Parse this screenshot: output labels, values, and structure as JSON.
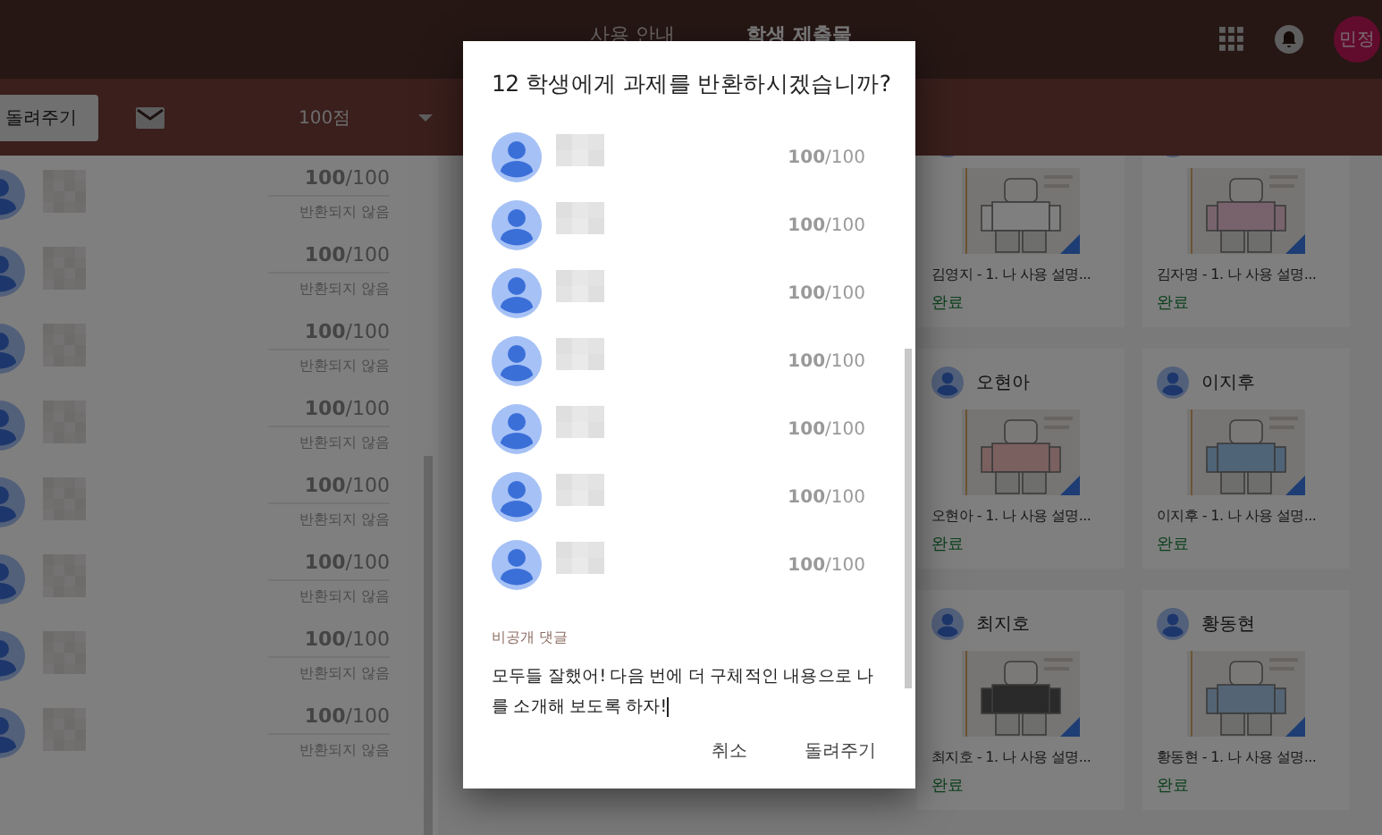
{
  "top_bar": {
    "tabs": [
      {
        "label": "사용 안내",
        "selected": false
      },
      {
        "label": "학생 제출물",
        "selected": true
      }
    ],
    "account_initials": "민정"
  },
  "toolbar": {
    "return_button": "돌려주기",
    "points_dropdown": "100점"
  },
  "student_list": [
    {
      "score": "**100**/100",
      "status": "반환되지 않음"
    },
    {
      "score": "**100**/100",
      "status": "반환되지 않음"
    },
    {
      "score": "**100**/100",
      "status": "반환되지 않음"
    },
    {
      "score": "**100**/100",
      "status": "반환되지 않음"
    },
    {
      "score": "**100**/100",
      "status": "반환되지 않음"
    },
    {
      "score": "**100**/100",
      "status": "반환되지 않음"
    },
    {
      "score": "**100**/100",
      "status": "반환되지 않음"
    },
    {
      "score": "**100**/100",
      "status": "반환되지 않음"
    }
  ],
  "cards": [
    {
      "title": "김영지 - 1. 나 사용 설명...",
      "status": "완료"
    },
    {
      "title": "김자명 - 1. 나 사용 설명...",
      "status": "완료"
    },
    {
      "name": "오현아",
      "title": "오현아 - 1. 나 사용 설명...",
      "status": "완료"
    },
    {
      "name": "이지후",
      "title": "이지후 - 1. 나 사용 설명...",
      "status": "완료"
    },
    {
      "name": "최지호",
      "title": "최지호 - 1. 나 사용 설명...",
      "status": "완료"
    },
    {
      "name": "황동현",
      "title": "황동현 - 1. 나 사용 설명...",
      "status": "완료"
    }
  ],
  "dialog": {
    "title": "12 학생에게 과제를 반환하시겠습니까?",
    "students": [
      {
        "score": "**100**/100"
      },
      {
        "score": "**100**/100"
      },
      {
        "score": "**100**/100"
      },
      {
        "score": "**100**/100"
      },
      {
        "score": "**100**/100"
      },
      {
        "score": "**100**/100"
      },
      {
        "score": "**100**/100"
      }
    ],
    "comment_label": "비공개 댓글",
    "comment": "모두들 잘했어! 다음 번에 더 구체적인 내용으로 나를 소개해 보도록 하자!",
    "buttons": [
      "취소",
      "돌려주기"
    ]
  }
}
